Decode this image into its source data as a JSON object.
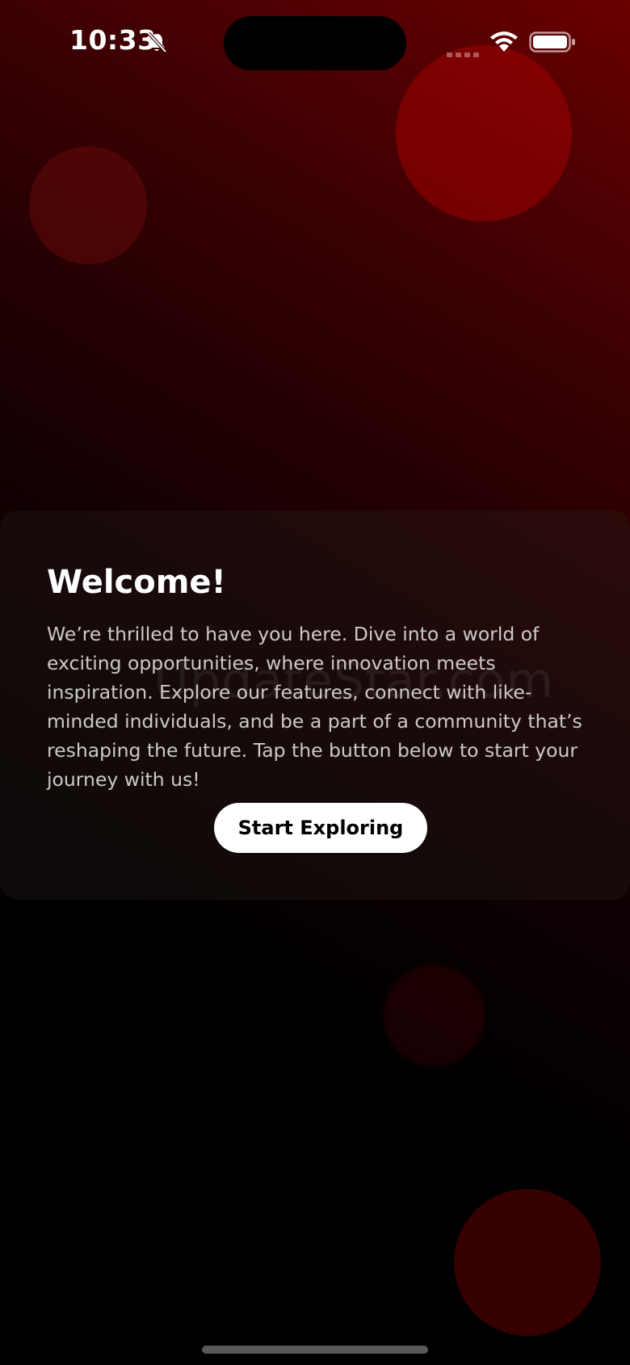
{
  "status_bar": {
    "time": "10:33",
    "icons": [
      "bell-slash-icon",
      "cellular-signal-icon",
      "wifi-icon",
      "battery-icon"
    ]
  },
  "card": {
    "title": "Welcome!",
    "body": "We’re thrilled to have you here. Dive into a world of exciting opportunities, where innovation meets inspiration. Explore our features, connect with like-minded individuals, and be a part of a community that’s reshaping the future. Tap the button below to start your journey with us!",
    "button_label": "Start Exploring"
  },
  "watermark": "UpdateStar.com",
  "colors": {
    "background_top": "#6a0000",
    "background_bottom": "#000000",
    "bubble": "#a00000",
    "button_bg": "#ffffff",
    "button_text": "#000000"
  }
}
